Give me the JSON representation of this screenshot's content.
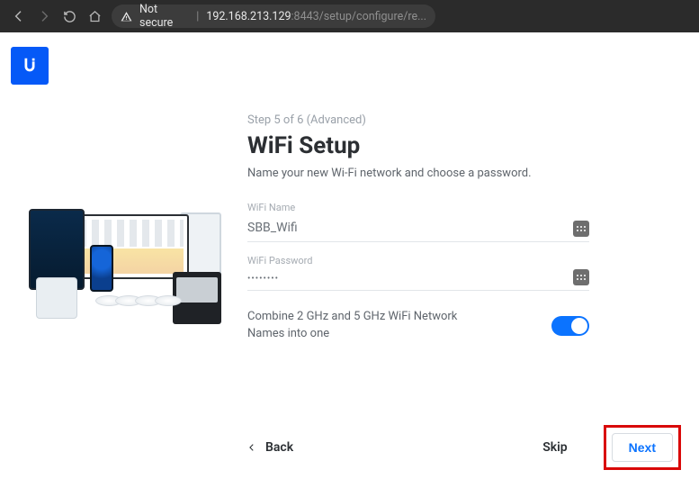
{
  "browser": {
    "security_text": "Not secure",
    "url_host": "192.168.213.129",
    "url_rest": ":8443/setup/configure/re..."
  },
  "setup": {
    "step_label": "Step 5 of 6 (Advanced)",
    "title": "WiFi Setup",
    "subtitle": "Name your new Wi-Fi network and choose a password.",
    "wifi_name_label": "WiFi Name",
    "wifi_name_value": "SBB_Wifi",
    "wifi_password_label": "WiFi Password",
    "wifi_password_value": "••••••••",
    "combine_label": "Combine 2 GHz and 5 GHz WiFi Network Names into one"
  },
  "footer": {
    "back": "Back",
    "skip": "Skip",
    "next": "Next"
  }
}
